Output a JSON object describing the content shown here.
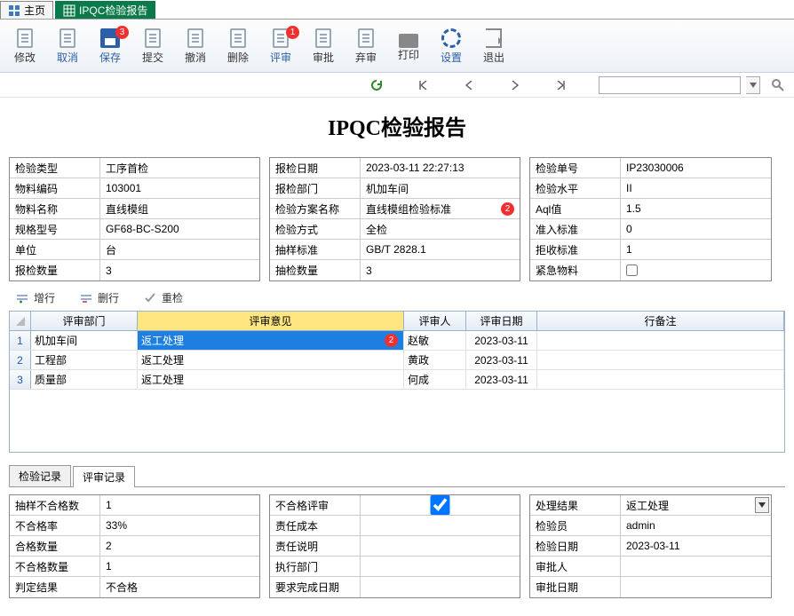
{
  "tabs": {
    "home": "主页",
    "report": "IPQC检验报告"
  },
  "toolbar": {
    "modify": "修改",
    "cancel": "取消",
    "save": "保存",
    "submit": "提交",
    "revoke": "撤消",
    "delete": "删除",
    "review": "评审",
    "approve": "审批",
    "abandon": "弃审",
    "print": "打印",
    "settings": "设置",
    "exit": "退出",
    "save_badge": "3",
    "review_badge": "1"
  },
  "title": "IPQC检验报告",
  "g1": [
    {
      "l": "检验类型",
      "v": "工序首检"
    },
    {
      "l": "物料编码",
      "v": "103001"
    },
    {
      "l": "物料名称",
      "v": "直线模组"
    },
    {
      "l": "规格型号",
      "v": "GF68-BC-S200"
    },
    {
      "l": "单位",
      "v": "台"
    },
    {
      "l": "报检数量",
      "v": "3"
    }
  ],
  "g2": [
    {
      "l": "报检日期",
      "v": "2023-03-11 22:27:13"
    },
    {
      "l": "报检部门",
      "v": "机加车间"
    },
    {
      "l": "检验方案名称",
      "v": "直线模组检验标准",
      "badge": "2"
    },
    {
      "l": "检验方式",
      "v": "全检"
    },
    {
      "l": "抽样标准",
      "v": "GB/T 2828.1"
    },
    {
      "l": "抽检数量",
      "v": "3"
    }
  ],
  "g3": [
    {
      "l": "检验单号",
      "v": "IP23030006"
    },
    {
      "l": "检验水平",
      "v": "II"
    },
    {
      "l": "Aql值",
      "v": "1.5"
    },
    {
      "l": "准入标准",
      "v": "0"
    },
    {
      "l": "拒收标准",
      "v": "1"
    },
    {
      "l": "紧急物料",
      "v": "",
      "checkbox": true
    }
  ],
  "sub": {
    "add": "增行",
    "del": "删行",
    "recheck": "重检"
  },
  "grid": {
    "head": {
      "dept": "评审部门",
      "op": "评审意见",
      "rev": "评审人",
      "date": "评审日期",
      "remark": "行备注"
    },
    "rows": [
      {
        "n": "1",
        "dept": "机加车间",
        "op": "返工处理",
        "rev": "赵敏",
        "date": "2023-03-11",
        "remark": "",
        "sel": true,
        "badge": "2"
      },
      {
        "n": "2",
        "dept": "工程部",
        "op": "返工处理",
        "rev": "黄政",
        "date": "2023-03-11",
        "remark": ""
      },
      {
        "n": "3",
        "dept": "质量部",
        "op": "返工处理",
        "rev": "何成",
        "date": "2023-03-11",
        "remark": ""
      }
    ]
  },
  "btabs": {
    "rec": "检验记录",
    "rev": "评审记录"
  },
  "b1": [
    {
      "l": "抽样不合格数",
      "v": "1"
    },
    {
      "l": "不合格率",
      "v": "33%"
    },
    {
      "l": "合格数量",
      "v": "2"
    },
    {
      "l": "不合格数量",
      "v": "1"
    },
    {
      "l": "判定结果",
      "v": "不合格"
    }
  ],
  "b2": [
    {
      "l": "不合格评审",
      "v": "",
      "checkbox": true,
      "checked": true
    },
    {
      "l": "责任成本",
      "v": ""
    },
    {
      "l": "责任说明",
      "v": ""
    },
    {
      "l": "执行部门",
      "v": ""
    },
    {
      "l": "要求完成日期",
      "v": ""
    }
  ],
  "b3": [
    {
      "l": "处理结果",
      "v": "返工处理",
      "dropdown": true
    },
    {
      "l": "检验员",
      "v": "admin"
    },
    {
      "l": "检验日期",
      "v": "2023-03-11"
    },
    {
      "l": "审批人",
      "v": ""
    },
    {
      "l": "审批日期",
      "v": ""
    }
  ]
}
